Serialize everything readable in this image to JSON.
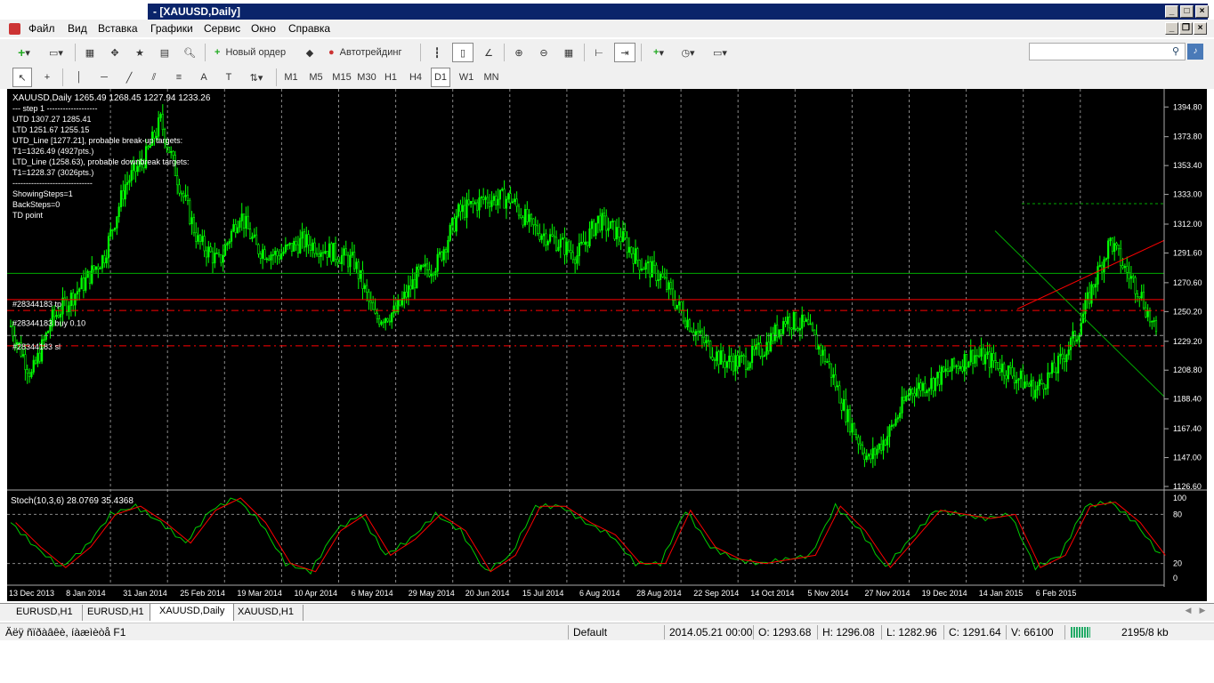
{
  "window": {
    "title": "- [XAUUSD,Daily]"
  },
  "menu": [
    "Файл",
    "Вид",
    "Вставка",
    "Графики",
    "Сервис",
    "Окно",
    "Справка"
  ],
  "toolbar": {
    "new_order": "Новый ордер",
    "autotrading": "Автотрейдинг"
  },
  "timeframes": [
    "M1",
    "M5",
    "M15",
    "M30",
    "H1",
    "H4",
    "D1",
    "W1",
    "MN"
  ],
  "active_timeframe": "D1",
  "chart": {
    "header": "XAUUSD,Daily  1265.49 1268.45 1227.94 1233.26",
    "info_lines": [
      "---  step 1  -------------------",
      "UTD 1307.27  1285.41",
      "LTD  1251.67  1255.15",
      "UTD_Line [1277.21], probable break-up targets:",
      "T1=1326.49 (4927pts.)",
      "LTD_Line (1258.63), probable downbreak targets:",
      "T1=1228.37 (3026pts.)",
      "------------------------------",
      "ShowingSteps=1",
      "BackSteps=0",
      "TD point"
    ],
    "order_labels": [
      "#28344183 tp",
      "#28344183 buy 0.10",
      "#28344183 sl"
    ],
    "current_price": "1233.26",
    "price_ticks": [
      "1394.80",
      "1373.80",
      "1353.40",
      "1333.00",
      "1312.00",
      "1291.60",
      "1270.60",
      "1250.20",
      "1229.20",
      "1208.80",
      "1188.40",
      "1167.40",
      "1147.00",
      "1126.60"
    ],
    "date_ticks": [
      "13 Dec 2013",
      "8 Jan 2014",
      "31 Jan 2014",
      "25 Feb 2014",
      "19 Mar 2014",
      "10 Apr 2014",
      "6 May 2014",
      "29 May 2014",
      "20 Jun 2014",
      "15 Jul 2014",
      "6 Aug 2014",
      "28 Aug 2014",
      "22 Sep 2014",
      "14 Oct 2014",
      "5 Nov 2014",
      "27 Nov 2014",
      "19 Dec 2014",
      "14 Jan 2015",
      "6 Feb 2015"
    ],
    "stoch_header": "Stoch(10,3,6) 28.0769 35.4368",
    "stoch_ticks": [
      "100",
      "80",
      "20",
      "0"
    ]
  },
  "chart_data": {
    "type": "candlestick",
    "symbol": "XAUUSD",
    "timeframe": "Daily",
    "ylim": [
      1126.6,
      1400
    ],
    "close_path": [
      [
        0,
        1240
      ],
      [
        10,
        1205
      ],
      [
        20,
        1245
      ],
      [
        35,
        1270
      ],
      [
        45,
        1290
      ],
      [
        55,
        1340
      ],
      [
        65,
        1360
      ],
      [
        72,
        1385
      ],
      [
        80,
        1345
      ],
      [
        90,
        1300
      ],
      [
        100,
        1285
      ],
      [
        110,
        1320
      ],
      [
        118,
        1295
      ],
      [
        128,
        1290
      ],
      [
        140,
        1300
      ],
      [
        150,
        1295
      ],
      [
        165,
        1285
      ],
      [
        175,
        1245
      ],
      [
        185,
        1250
      ],
      [
        195,
        1275
      ],
      [
        205,
        1285
      ],
      [
        215,
        1320
      ],
      [
        228,
        1330
      ],
      [
        240,
        1330
      ],
      [
        250,
        1310
      ],
      [
        262,
        1300
      ],
      [
        272,
        1290
      ],
      [
        282,
        1315
      ],
      [
        292,
        1305
      ],
      [
        302,
        1285
      ],
      [
        312,
        1275
      ],
      [
        322,
        1250
      ],
      [
        332,
        1230
      ],
      [
        342,
        1215
      ],
      [
        352,
        1215
      ],
      [
        362,
        1225
      ],
      [
        372,
        1245
      ],
      [
        382,
        1240
      ],
      [
        392,
        1215
      ],
      [
        402,
        1175
      ],
      [
        412,
        1145
      ],
      [
        422,
        1165
      ],
      [
        432,
        1195
      ],
      [
        442,
        1200
      ],
      [
        452,
        1210
      ],
      [
        462,
        1220
      ],
      [
        472,
        1215
      ],
      [
        482,
        1205
      ],
      [
        492,
        1195
      ],
      [
        502,
        1210
      ],
      [
        512,
        1235
      ],
      [
        520,
        1270
      ],
      [
        528,
        1300
      ],
      [
        535,
        1280
      ],
      [
        542,
        1265
      ],
      [
        550,
        1233
      ]
    ],
    "stoch_main": [
      [
        0,
        70
      ],
      [
        10,
        40
      ],
      [
        20,
        15
      ],
      [
        30,
        40
      ],
      [
        40,
        80
      ],
      [
        50,
        90
      ],
      [
        60,
        70
      ],
      [
        70,
        45
      ],
      [
        80,
        85
      ],
      [
        90,
        100
      ],
      [
        100,
        70
      ],
      [
        110,
        20
      ],
      [
        120,
        10
      ],
      [
        130,
        60
      ],
      [
        140,
        80
      ],
      [
        150,
        30
      ],
      [
        160,
        50
      ],
      [
        170,
        80
      ],
      [
        180,
        60
      ],
      [
        190,
        10
      ],
      [
        200,
        30
      ],
      [
        210,
        90
      ],
      [
        220,
        90
      ],
      [
        230,
        70
      ],
      [
        240,
        55
      ],
      [
        250,
        20
      ],
      [
        260,
        20
      ],
      [
        270,
        85
      ],
      [
        280,
        40
      ],
      [
        290,
        25
      ],
      [
        300,
        20
      ],
      [
        310,
        25
      ],
      [
        320,
        30
      ],
      [
        330,
        90
      ],
      [
        340,
        60
      ],
      [
        350,
        15
      ],
      [
        360,
        50
      ],
      [
        370,
        85
      ],
      [
        380,
        80
      ],
      [
        390,
        75
      ],
      [
        400,
        80
      ],
      [
        410,
        15
      ],
      [
        420,
        30
      ],
      [
        430,
        90
      ],
      [
        440,
        95
      ],
      [
        450,
        70
      ],
      [
        460,
        30
      ]
    ]
  },
  "tabs": [
    "EURUSD,H1",
    "EURUSD,H1",
    "XAUUSD,Daily",
    "XAUUSD,H1"
  ],
  "active_tab": "XAUUSD,Daily",
  "status": {
    "help": "Äëÿ ñïðàâêè, íàæìèòå F1",
    "profile": "Default",
    "date": "2014.05.21 00:00",
    "open": "O: 1293.68",
    "high": "H: 1296.08",
    "low": "L: 1282.96",
    "close": "C: 1291.64",
    "volume": "V: 66100",
    "traffic": "2195/8 kb"
  },
  "colors": {
    "candle": "#00ff00",
    "stoch_main": "#00cc00",
    "stoch_signal": "#ff0000",
    "order_line": "#ff0000",
    "utd_line": "#ff0000",
    "ltd_line": "#00aa00"
  }
}
